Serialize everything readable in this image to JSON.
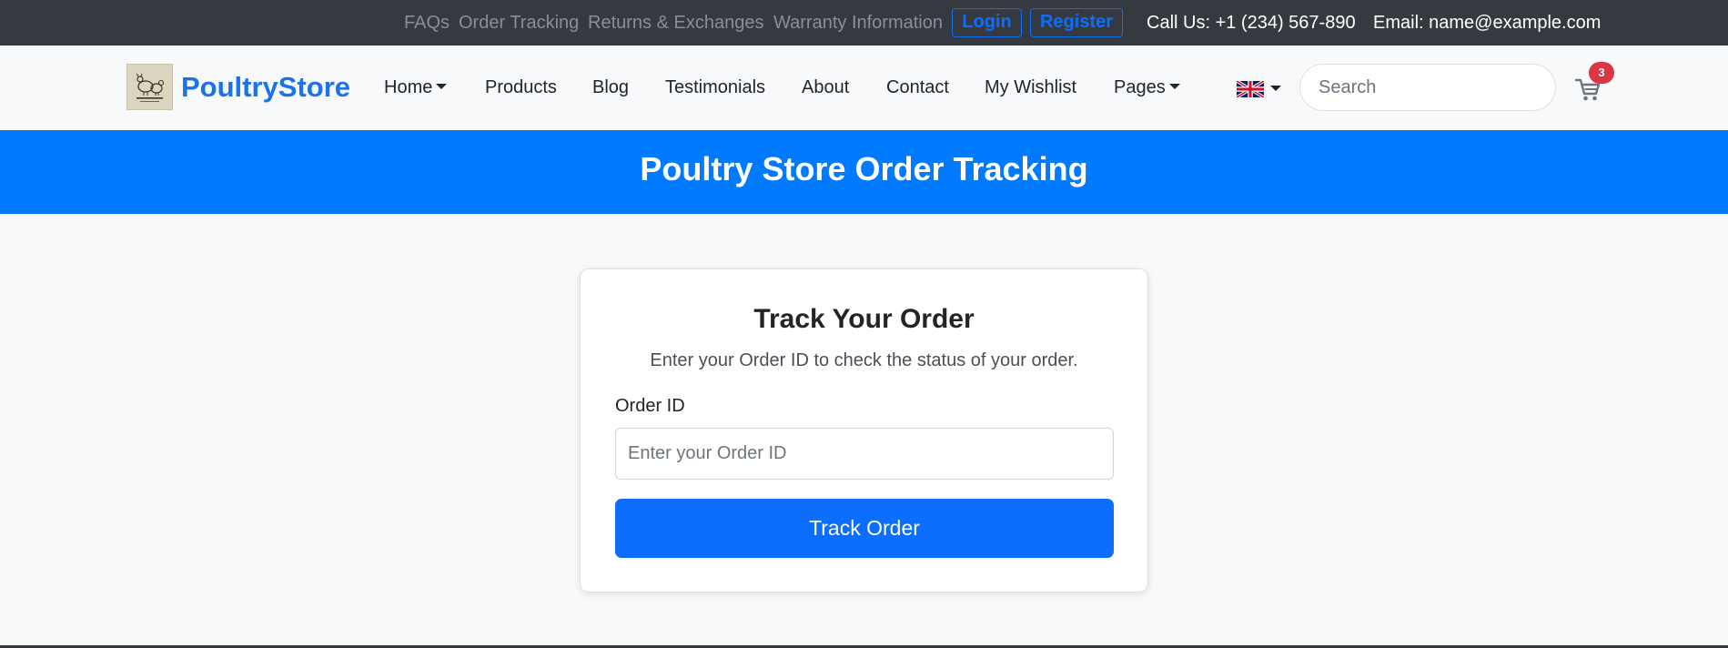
{
  "topbar": {
    "links": [
      "FAQs",
      "Order Tracking",
      "Returns & Exchanges",
      "Warranty Information"
    ],
    "login_label": "Login",
    "register_label": "Register",
    "phone": "Call Us: +1 (234) 567-890",
    "email": "Email: name@example.com"
  },
  "navbar": {
    "brand": "PoultryStore",
    "items": [
      "Home",
      "Products",
      "Blog",
      "Testimonials",
      "About",
      "Contact",
      "My Wishlist",
      "Pages"
    ],
    "search_placeholder": "Search",
    "cart_count": "3"
  },
  "banner": {
    "title": "Poultry Store Order Tracking"
  },
  "tracking_card": {
    "title": "Track Your Order",
    "subtitle": "Enter your Order ID to check the status of your order.",
    "field_label": "Order ID",
    "field_placeholder": "Enter your Order ID",
    "field_value": "",
    "button_label": "Track Order"
  },
  "icons": {
    "language": "uk-flag-icon",
    "cart": "shopping-cart-icon",
    "dropdown": "caret-down-icon"
  },
  "colors": {
    "topbar_bg": "#343a40",
    "primary": "#0d6efd",
    "banner_bg": "#007bff",
    "brand": "#1a73e8",
    "badge": "#dc3545",
    "page_bg": "#f8f9fa"
  }
}
